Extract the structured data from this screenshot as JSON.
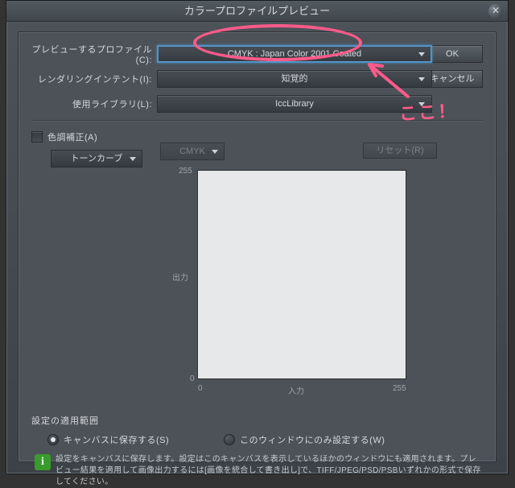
{
  "title": "カラープロファイルプレビュー",
  "buttons": {
    "ok": "OK",
    "cancel": "キャンセル",
    "reset": "リセット(R)"
  },
  "labels": {
    "profile": "プレビューするプロファイル(C):",
    "intent": "レンダリングインテント(I):",
    "library": "使用ライブラリ(L):",
    "tone": "色調補正(A)"
  },
  "selects": {
    "profile": "CMYK : Japan Color 2001 Coated",
    "intent": "知覚的",
    "library": "IccLibrary",
    "colormodel": "CMYK",
    "curve": "トーンカーブ"
  },
  "graph": {
    "ylabel": "出力",
    "xlabel": "入力",
    "y_max": "255",
    "y_min": "0",
    "x_min": "0",
    "x_max": "255"
  },
  "scope": {
    "title": "設定の適用範囲",
    "opt1": "キャンバスに保存する(S)",
    "opt2": "このウィンドウにのみ設定する(W)",
    "info": "設定をキャンバスに保存します。設定はこのキャンバスを表示しているほかのウィンドウにも適用されます。プレビュー結果を適用して画像出力するには[画像を統合して書き出し]で、TIFF/JPEG/PSD/PSBいずれかの形式で保存してください。"
  },
  "annotation": "ここ！"
}
